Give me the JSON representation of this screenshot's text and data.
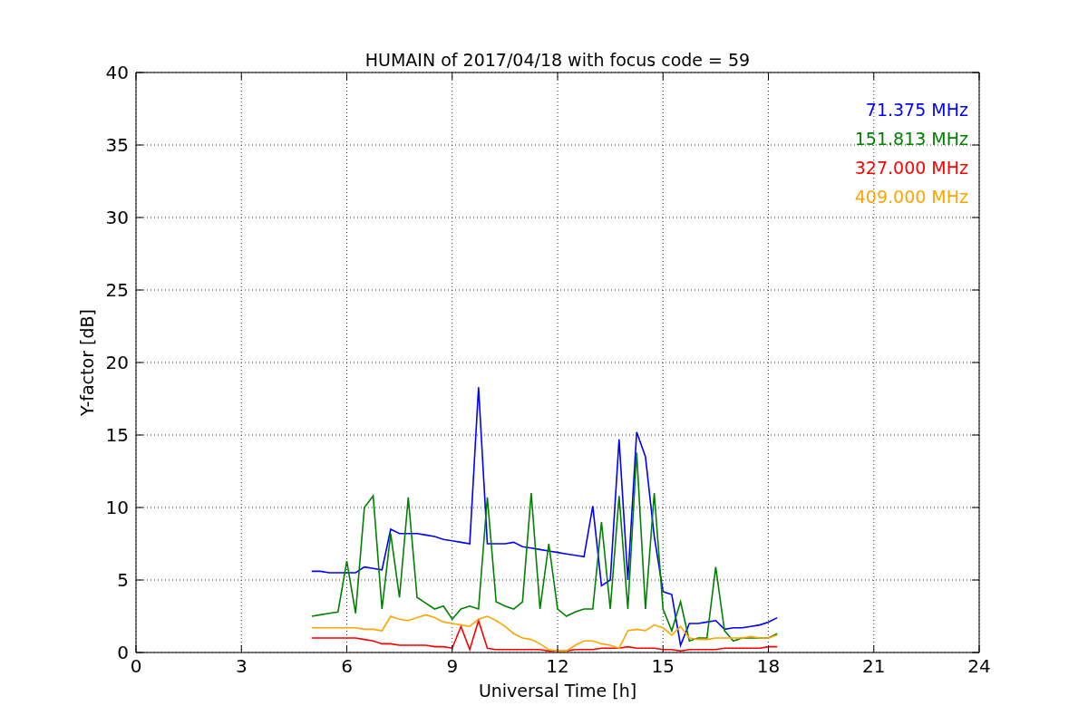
{
  "plot": {
    "chart_data": {
      "type": "line",
      "grid": true,
      "title": "HUMAIN of 2017/04/18 with focus code = 59",
      "xlabel": "Universal Time [h]",
      "ylabel": "Y-factor [dB]",
      "xlim": [
        0,
        24
      ],
      "ylim": [
        0,
        40
      ],
      "xticks": [
        0,
        3,
        6,
        9,
        12,
        15,
        18,
        21,
        24
      ],
      "yticks": [
        0,
        5,
        10,
        15,
        20,
        25,
        30,
        35,
        40
      ],
      "x": [
        5,
        5.25,
        5.5,
        5.75,
        6,
        6.25,
        6.5,
        6.75,
        7,
        7.25,
        7.5,
        7.75,
        8,
        8.25,
        8.5,
        8.75,
        9,
        9.25,
        9.5,
        9.75,
        10,
        10.25,
        10.5,
        10.75,
        11,
        11.25,
        11.5,
        11.75,
        12,
        12.25,
        12.5,
        12.75,
        13,
        13.25,
        13.5,
        13.75,
        14,
        14.25,
        14.5,
        14.75,
        15,
        15.25,
        15.5,
        15.75,
        16,
        16.25,
        16.5,
        16.75,
        17,
        17.25,
        17.5,
        17.75,
        18,
        18.25
      ],
      "series": [
        {
          "name": "71.375 MHz",
          "color": "#0000ff",
          "values": [
            5.6,
            5.6,
            5.5,
            5.5,
            5.5,
            5.5,
            5.9,
            5.8,
            5.7,
            8.5,
            8.2,
            8.2,
            8.2,
            8.1,
            8.0,
            7.8,
            7.7,
            7.6,
            7.5,
            18.3,
            7.5,
            7.5,
            7.5,
            7.6,
            7.3,
            7.2,
            7.1,
            7.0,
            6.9,
            6.8,
            6.7,
            6.6,
            10.1,
            4.6,
            5.0,
            14.7,
            5.0,
            15.2,
            13.5,
            8.0,
            4.2,
            4.0,
            0.5,
            2.0,
            2.0,
            2.1,
            2.2,
            1.6,
            1.7,
            1.7,
            1.8,
            1.9,
            2.1,
            2.4
          ]
        },
        {
          "name": "151.813 MHz",
          "color": "#008000",
          "values": [
            2.5,
            2.6,
            2.7,
            2.8,
            6.3,
            2.7,
            10.0,
            10.8,
            3.0,
            8.2,
            3.8,
            10.7,
            3.8,
            3.4,
            3.0,
            3.2,
            2.3,
            3.0,
            3.2,
            3.0,
            10.7,
            3.5,
            3.2,
            3.0,
            3.5,
            11.0,
            3.0,
            7.5,
            3.0,
            2.5,
            2.8,
            3.0,
            3.0,
            9.0,
            3.0,
            10.8,
            3.0,
            13.8,
            3.0,
            11.0,
            3.0,
            1.5,
            3.5,
            0.8,
            1.0,
            1.0,
            5.9,
            1.5,
            0.8,
            1.0,
            1.0,
            1.0,
            1.0,
            1.3
          ]
        },
        {
          "name": "327.000 MHz",
          "color": "#ff0000",
          "values": [
            1.0,
            1.0,
            1.0,
            1.0,
            1.0,
            1.0,
            0.9,
            0.8,
            0.6,
            0.6,
            0.5,
            0.5,
            0.5,
            0.5,
            0.4,
            0.4,
            0.3,
            1.8,
            0.2,
            2.2,
            0.3,
            0.2,
            0.2,
            0.2,
            0.2,
            0.2,
            0.2,
            0.1,
            0.1,
            0.1,
            0.2,
            0.2,
            0.2,
            0.3,
            0.3,
            0.3,
            0.4,
            0.3,
            0.3,
            0.3,
            0.2,
            0.2,
            0.1,
            0.2,
            0.2,
            0.2,
            0.2,
            0.3,
            0.3,
            0.3,
            0.3,
            0.3,
            0.4,
            0.4
          ]
        },
        {
          "name": "409.000 MHz",
          "color": "#ffa500",
          "values": [
            1.7,
            1.7,
            1.7,
            1.7,
            1.7,
            1.7,
            1.6,
            1.6,
            1.5,
            2.5,
            2.3,
            2.2,
            2.4,
            2.6,
            2.4,
            2.1,
            2.0,
            1.9,
            1.8,
            2.3,
            2.5,
            2.2,
            1.8,
            1.3,
            1.0,
            0.9,
            0.6,
            0.2,
            0.1,
            0.1,
            0.5,
            0.8,
            0.8,
            0.6,
            0.5,
            0.3,
            1.5,
            1.6,
            1.5,
            1.9,
            1.7,
            1.2,
            1.8,
            1.0,
            0.9,
            0.9,
            1.0,
            1.0,
            1.0,
            1.0,
            1.1,
            1.0,
            1.0,
            1.2
          ]
        }
      ]
    }
  }
}
